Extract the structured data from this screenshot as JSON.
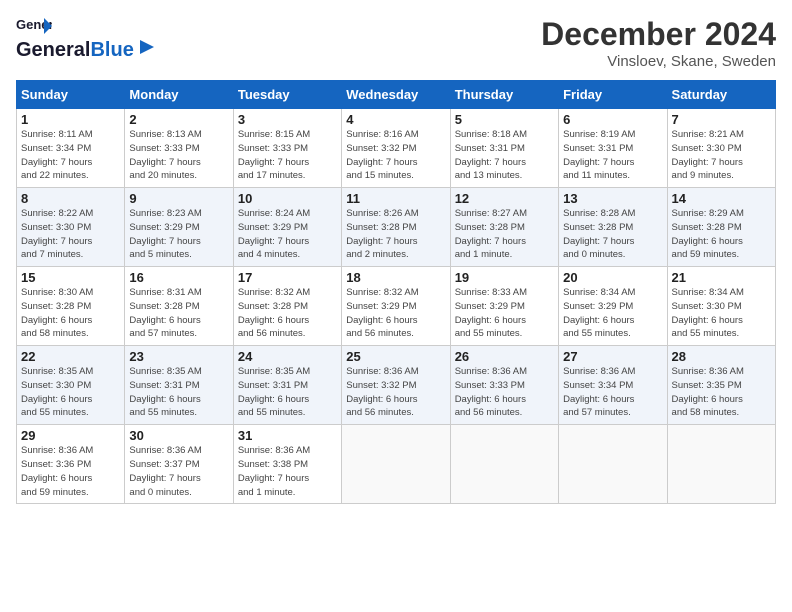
{
  "header": {
    "logo_line1": "General",
    "logo_line2": "Blue",
    "month_title": "December 2024",
    "location": "Vinsloev, Skane, Sweden"
  },
  "days_of_week": [
    "Sunday",
    "Monday",
    "Tuesday",
    "Wednesday",
    "Thursday",
    "Friday",
    "Saturday"
  ],
  "weeks": [
    [
      {
        "day": "1",
        "info": "Sunrise: 8:11 AM\nSunset: 3:34 PM\nDaylight: 7 hours\nand 22 minutes."
      },
      {
        "day": "2",
        "info": "Sunrise: 8:13 AM\nSunset: 3:33 PM\nDaylight: 7 hours\nand 20 minutes."
      },
      {
        "day": "3",
        "info": "Sunrise: 8:15 AM\nSunset: 3:33 PM\nDaylight: 7 hours\nand 17 minutes."
      },
      {
        "day": "4",
        "info": "Sunrise: 8:16 AM\nSunset: 3:32 PM\nDaylight: 7 hours\nand 15 minutes."
      },
      {
        "day": "5",
        "info": "Sunrise: 8:18 AM\nSunset: 3:31 PM\nDaylight: 7 hours\nand 13 minutes."
      },
      {
        "day": "6",
        "info": "Sunrise: 8:19 AM\nSunset: 3:31 PM\nDaylight: 7 hours\nand 11 minutes."
      },
      {
        "day": "7",
        "info": "Sunrise: 8:21 AM\nSunset: 3:30 PM\nDaylight: 7 hours\nand 9 minutes."
      }
    ],
    [
      {
        "day": "8",
        "info": "Sunrise: 8:22 AM\nSunset: 3:30 PM\nDaylight: 7 hours\nand 7 minutes."
      },
      {
        "day": "9",
        "info": "Sunrise: 8:23 AM\nSunset: 3:29 PM\nDaylight: 7 hours\nand 5 minutes."
      },
      {
        "day": "10",
        "info": "Sunrise: 8:24 AM\nSunset: 3:29 PM\nDaylight: 7 hours\nand 4 minutes."
      },
      {
        "day": "11",
        "info": "Sunrise: 8:26 AM\nSunset: 3:28 PM\nDaylight: 7 hours\nand 2 minutes."
      },
      {
        "day": "12",
        "info": "Sunrise: 8:27 AM\nSunset: 3:28 PM\nDaylight: 7 hours\nand 1 minute."
      },
      {
        "day": "13",
        "info": "Sunrise: 8:28 AM\nSunset: 3:28 PM\nDaylight: 7 hours\nand 0 minutes."
      },
      {
        "day": "14",
        "info": "Sunrise: 8:29 AM\nSunset: 3:28 PM\nDaylight: 6 hours\nand 59 minutes."
      }
    ],
    [
      {
        "day": "15",
        "info": "Sunrise: 8:30 AM\nSunset: 3:28 PM\nDaylight: 6 hours\nand 58 minutes."
      },
      {
        "day": "16",
        "info": "Sunrise: 8:31 AM\nSunset: 3:28 PM\nDaylight: 6 hours\nand 57 minutes."
      },
      {
        "day": "17",
        "info": "Sunrise: 8:32 AM\nSunset: 3:28 PM\nDaylight: 6 hours\nand 56 minutes."
      },
      {
        "day": "18",
        "info": "Sunrise: 8:32 AM\nSunset: 3:29 PM\nDaylight: 6 hours\nand 56 minutes."
      },
      {
        "day": "19",
        "info": "Sunrise: 8:33 AM\nSunset: 3:29 PM\nDaylight: 6 hours\nand 55 minutes."
      },
      {
        "day": "20",
        "info": "Sunrise: 8:34 AM\nSunset: 3:29 PM\nDaylight: 6 hours\nand 55 minutes."
      },
      {
        "day": "21",
        "info": "Sunrise: 8:34 AM\nSunset: 3:30 PM\nDaylight: 6 hours\nand 55 minutes."
      }
    ],
    [
      {
        "day": "22",
        "info": "Sunrise: 8:35 AM\nSunset: 3:30 PM\nDaylight: 6 hours\nand 55 minutes."
      },
      {
        "day": "23",
        "info": "Sunrise: 8:35 AM\nSunset: 3:31 PM\nDaylight: 6 hours\nand 55 minutes."
      },
      {
        "day": "24",
        "info": "Sunrise: 8:35 AM\nSunset: 3:31 PM\nDaylight: 6 hours\nand 55 minutes."
      },
      {
        "day": "25",
        "info": "Sunrise: 8:36 AM\nSunset: 3:32 PM\nDaylight: 6 hours\nand 56 minutes."
      },
      {
        "day": "26",
        "info": "Sunrise: 8:36 AM\nSunset: 3:33 PM\nDaylight: 6 hours\nand 56 minutes."
      },
      {
        "day": "27",
        "info": "Sunrise: 8:36 AM\nSunset: 3:34 PM\nDaylight: 6 hours\nand 57 minutes."
      },
      {
        "day": "28",
        "info": "Sunrise: 8:36 AM\nSunset: 3:35 PM\nDaylight: 6 hours\nand 58 minutes."
      }
    ],
    [
      {
        "day": "29",
        "info": "Sunrise: 8:36 AM\nSunset: 3:36 PM\nDaylight: 6 hours\nand 59 minutes."
      },
      {
        "day": "30",
        "info": "Sunrise: 8:36 AM\nSunset: 3:37 PM\nDaylight: 7 hours\nand 0 minutes."
      },
      {
        "day": "31",
        "info": "Sunrise: 8:36 AM\nSunset: 3:38 PM\nDaylight: 7 hours\nand 1 minute."
      },
      null,
      null,
      null,
      null
    ]
  ]
}
